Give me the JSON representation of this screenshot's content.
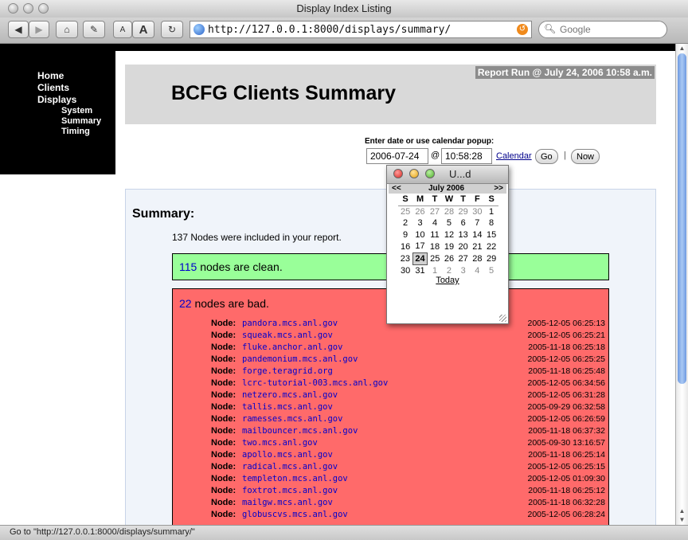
{
  "window": {
    "title": "Display Index Listing"
  },
  "toolbar": {
    "url": "http://127.0.0.1:8000/displays/summary/",
    "search_placeholder": "Google",
    "text_small": "A",
    "text_large": "A"
  },
  "nav": {
    "items": [
      {
        "label": "Home"
      },
      {
        "label": "Clients"
      },
      {
        "label": "Displays"
      }
    ],
    "subitems": [
      {
        "label": "System"
      },
      {
        "label": "Summary"
      },
      {
        "label": "Timing"
      }
    ]
  },
  "header": {
    "report_run": "Report Run @ July 24, 2006 10:58 a.m.",
    "title": "BCFG Clients Summary"
  },
  "date_form": {
    "label": "Enter date or use calendar popup:",
    "date": "2006-07-24",
    "at": "@",
    "time": "10:58:28",
    "calendar_link": "Calendar",
    "go_label": "Go",
    "separator": "|",
    "now_label": "Now"
  },
  "summary": {
    "heading": "Summary:",
    "nodes_included": "137 Nodes were included in your report.",
    "clean_count": "115",
    "clean_text": " nodes are clean.",
    "bad_count": "22",
    "bad_text": " nodes are bad.",
    "node_label": "Node:",
    "bad_nodes": [
      {
        "host": "pandora.mcs.anl.gov",
        "time": "2005-12-05 06:25:13"
      },
      {
        "host": "squeak.mcs.anl.gov",
        "time": "2005-12-05 06:25:21"
      },
      {
        "host": "fluke.anchor.anl.gov",
        "time": "2005-11-18 06:25:18"
      },
      {
        "host": "pandemonium.mcs.anl.gov",
        "time": "2005-12-05 06:25:25"
      },
      {
        "host": "forge.teragrid.org",
        "time": "2005-11-18 06:25:48"
      },
      {
        "host": "lcrc-tutorial-003.mcs.anl.gov",
        "time": "2005-12-05 06:34:56"
      },
      {
        "host": "netzero.mcs.anl.gov",
        "time": "2005-12-05 06:31:28"
      },
      {
        "host": "tallis.mcs.anl.gov",
        "time": "2005-09-29 06:32:58"
      },
      {
        "host": "ramesses.mcs.anl.gov",
        "time": "2005-12-05 06:26:59"
      },
      {
        "host": "mailbouncer.mcs.anl.gov",
        "time": "2005-11-18 06:37:32"
      },
      {
        "host": "two.mcs.anl.gov",
        "time": "2005-09-30 13:16:57"
      },
      {
        "host": "apollo.mcs.anl.gov",
        "time": "2005-11-18 06:25:14"
      },
      {
        "host": "radical.mcs.anl.gov",
        "time": "2005-12-05 06:25:15"
      },
      {
        "host": "templeton.mcs.anl.gov",
        "time": "2005-12-05 01:09:30"
      },
      {
        "host": "foxtrot.mcs.anl.gov",
        "time": "2005-11-18 06:25:12"
      },
      {
        "host": "mailgw.mcs.anl.gov",
        "time": "2005-11-18 06:32:28"
      },
      {
        "host": "globuscvs.mcs.anl.gov",
        "time": "2005-12-05 06:28:24"
      }
    ]
  },
  "calendar": {
    "title": "U...d",
    "prev": "<<",
    "month": "July 2006",
    "next": ">>",
    "dow": [
      "S",
      "M",
      "T",
      "W",
      "T",
      "F",
      "S"
    ],
    "weeks": [
      [
        {
          "d": "25",
          "o": true
        },
        {
          "d": "26",
          "o": true
        },
        {
          "d": "27",
          "o": true
        },
        {
          "d": "28",
          "o": true
        },
        {
          "d": "29",
          "o": true
        },
        {
          "d": "30",
          "o": true
        },
        {
          "d": "1"
        }
      ],
      [
        {
          "d": "2"
        },
        {
          "d": "3"
        },
        {
          "d": "4"
        },
        {
          "d": "5"
        },
        {
          "d": "6"
        },
        {
          "d": "7"
        },
        {
          "d": "8"
        }
      ],
      [
        {
          "d": "9"
        },
        {
          "d": "10"
        },
        {
          "d": "11"
        },
        {
          "d": "12"
        },
        {
          "d": "13"
        },
        {
          "d": "14"
        },
        {
          "d": "15"
        }
      ],
      [
        {
          "d": "16"
        },
        {
          "d": "17"
        },
        {
          "d": "18"
        },
        {
          "d": "19"
        },
        {
          "d": "20"
        },
        {
          "d": "21"
        },
        {
          "d": "22"
        }
      ],
      [
        {
          "d": "23"
        },
        {
          "d": "24",
          "t": true
        },
        {
          "d": "25"
        },
        {
          "d": "26"
        },
        {
          "d": "27"
        },
        {
          "d": "28"
        },
        {
          "d": "29"
        }
      ],
      [
        {
          "d": "30"
        },
        {
          "d": "31"
        },
        {
          "d": "1",
          "o": true
        },
        {
          "d": "2",
          "o": true
        },
        {
          "d": "3",
          "o": true
        },
        {
          "d": "4",
          "o": true
        },
        {
          "d": "5",
          "o": true
        }
      ]
    ],
    "today_label": "Today"
  },
  "status": {
    "text": "Go to \"http://127.0.0.1:8000/displays/summary/\""
  },
  "colors": {
    "clean_bg": "#99ff99",
    "bad_bg": "#ff6a6a",
    "nav_bg": "#000000",
    "link": "#0000cc"
  }
}
